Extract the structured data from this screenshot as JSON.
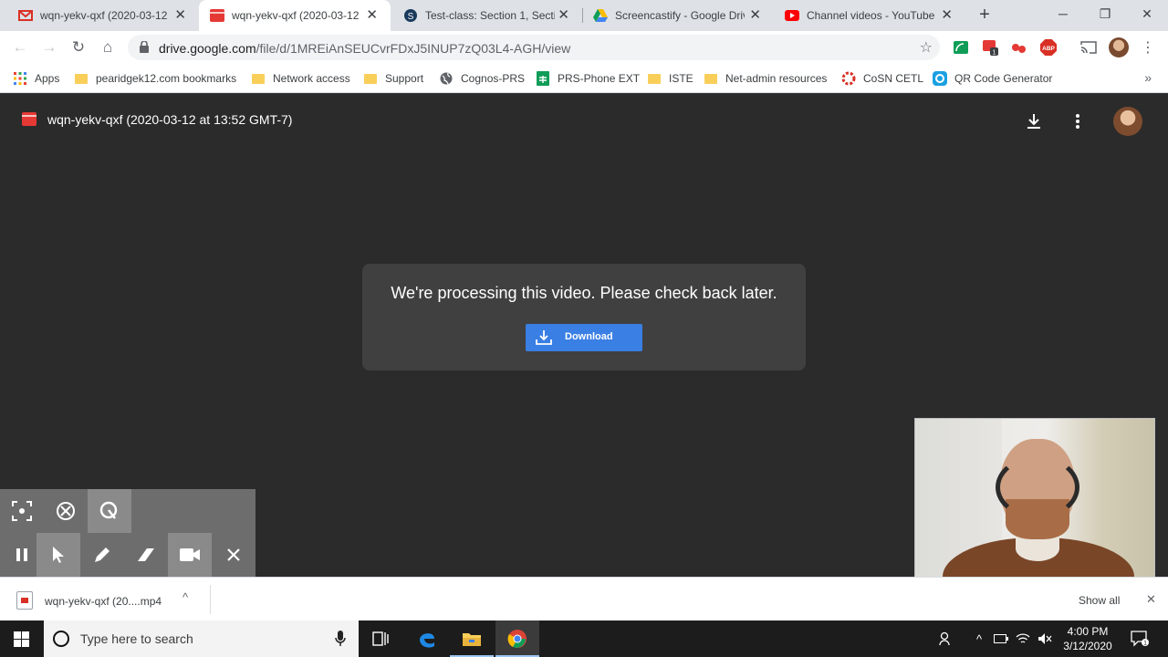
{
  "browser": {
    "tabs": [
      {
        "title": "wqn-yekv-qxf (2020-03-12",
        "favicon": "gmail-icon",
        "badge": "2"
      },
      {
        "title": "wqn-yekv-qxf (2020-03-12",
        "favicon": "video-file-icon"
      },
      {
        "title": "Test-class: Section 1, Sectio",
        "favicon": "schoology-icon"
      },
      {
        "title": "Screencastify - Google Driv",
        "favicon": "google-drive-icon"
      },
      {
        "title": "Channel videos - YouTube S",
        "favicon": "youtube-icon"
      }
    ],
    "url_host": "drive.google.com",
    "url_path": "/file/d/1MREiAnSEUCvrFDxJ5INUP7zQ03L4-AGH/view",
    "extension_badge": "1",
    "adblock_label": "ABP"
  },
  "bookmarks": {
    "items": [
      {
        "label": "Apps",
        "icon": "apps-grid-icon"
      },
      {
        "label": "pearidgek12.com bookmarks",
        "icon": "folder-icon"
      },
      {
        "label": "Network access",
        "icon": "folder-icon"
      },
      {
        "label": "Support",
        "icon": "folder-icon"
      },
      {
        "label": "Cognos-PRS",
        "icon": "globe-icon"
      },
      {
        "label": "PRS-Phone EXT",
        "icon": "sheets-icon"
      },
      {
        "label": "ISTE",
        "icon": "folder-icon"
      },
      {
        "label": "Net-admin resources",
        "icon": "folder-icon"
      },
      {
        "label": "CoSN CETL",
        "icon": "cosn-icon"
      },
      {
        "label": "QR Code Generator",
        "icon": "qr-icon"
      }
    ]
  },
  "viewer": {
    "title": "wqn-yekv-qxf (2020-03-12 at 13:52 GMT-7)",
    "message": "We're processing this video. Please check back later.",
    "download_label": "Download"
  },
  "shelf": {
    "file": "wqn-yekv-qxf (20....mp4",
    "show_all": "Show all"
  },
  "taskbar": {
    "search_placeholder": "Type here to search",
    "time": "4:00 PM",
    "date": "3/12/2020",
    "notification_count": "1"
  },
  "colors": {
    "viewer_bg": "#2b2b2b",
    "dialog_bg": "#404040",
    "download_button": "#3a7fe4",
    "screencastify_bar": "#6d6d6d"
  }
}
